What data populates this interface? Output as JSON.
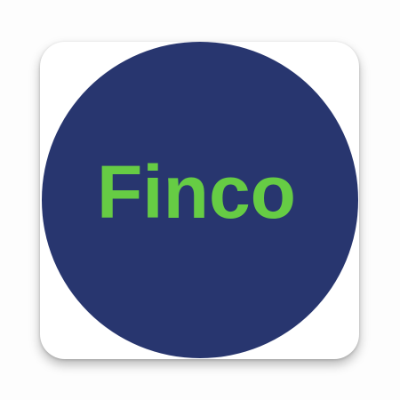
{
  "app_icon": {
    "logo_text": "Finco",
    "colors": {
      "circle": "#28366f",
      "text": "#66cc44",
      "tile": "#ffffff"
    }
  }
}
